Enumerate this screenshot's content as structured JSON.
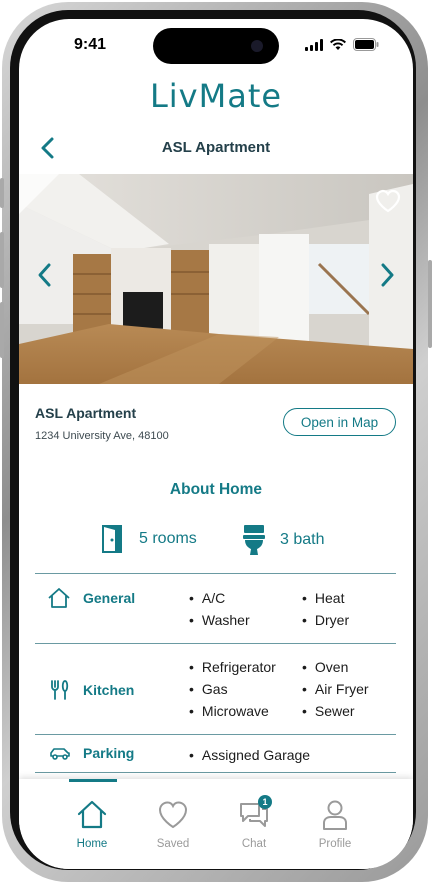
{
  "status_bar": {
    "time": "9:41"
  },
  "app": {
    "logo_text": "LivMate",
    "brand_color": "#147a86"
  },
  "header": {
    "title": "ASL Apartment"
  },
  "listing": {
    "name": "ASL Apartment",
    "address": "1234 University Ave, 48100",
    "map_button": "Open in Map"
  },
  "about": {
    "title": "About Home",
    "rooms": "5 rooms",
    "bath": "3 bath"
  },
  "amenities": {
    "general": {
      "label": "General",
      "col1": [
        "A/C",
        "Washer"
      ],
      "col2": [
        "Heat",
        "Dryer"
      ]
    },
    "kitchen": {
      "label": "Kitchen",
      "col1": [
        "Refrigerator",
        "Gas",
        "Microwave"
      ],
      "col2": [
        "Oven",
        "Air Fryer",
        "Sewer"
      ]
    },
    "parking": {
      "label": "Parking",
      "col1": [
        "Assigned Garage"
      ]
    }
  },
  "tabbar": {
    "home": "Home",
    "saved": "Saved",
    "chat": "Chat",
    "chat_badge": "1",
    "profile": "Profile"
  }
}
